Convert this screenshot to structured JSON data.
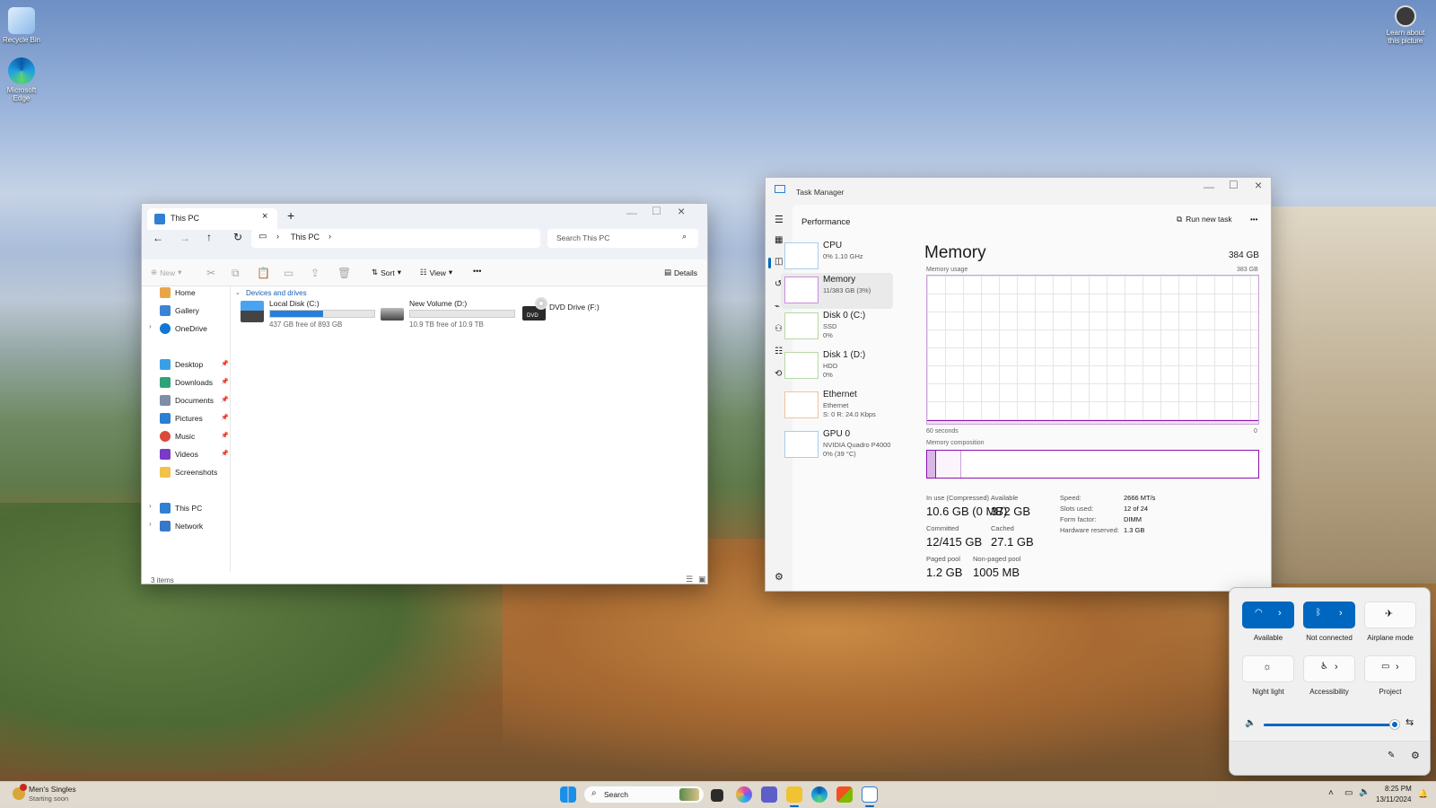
{
  "desktop": {
    "icons": [
      {
        "label": "Recycle Bin"
      },
      {
        "label": "Microsoft Edge"
      },
      {
        "label": "Learn about this picture"
      }
    ]
  },
  "explorer": {
    "tab_title": "This PC",
    "new_tab": "+",
    "breadcrumb": [
      "This PC"
    ],
    "search_placeholder": "Search This PC",
    "toolbar": {
      "new": "New",
      "sort": "Sort",
      "view": "View",
      "more": "•••",
      "details": "Details"
    },
    "nav": {
      "home": "Home",
      "gallery": "Gallery",
      "onedrive": "OneDrive",
      "desktop": "Desktop",
      "downloads": "Downloads",
      "documents": "Documents",
      "pictures": "Pictures",
      "music": "Music",
      "videos": "Videos",
      "screenshots": "Screenshots",
      "this_pc": "This PC",
      "network": "Network"
    },
    "section": "Devices and drives",
    "drives": [
      {
        "name": "Local Disk (C:)",
        "free": "437 GB free of 893 GB",
        "used_fraction": 0.51
      },
      {
        "name": "New Volume (D:)",
        "free": "10.9 TB free of 10.9 TB",
        "used_fraction": 0.0
      },
      {
        "name": "DVD Drive (F:)",
        "badge": "DVD"
      }
    ],
    "status": "3 items"
  },
  "taskmanager": {
    "title": "Task Manager",
    "page": "Performance",
    "run_task": "Run new task",
    "more": "•••",
    "items": [
      {
        "name": "CPU",
        "sub": "0% 1.10 GHz"
      },
      {
        "name": "Memory",
        "sub": "11/383 GB (3%)"
      },
      {
        "name": "Disk 0 (C:)",
        "sub": "SSD",
        "sub2": "0%"
      },
      {
        "name": "Disk 1 (D:)",
        "sub": "HDD",
        "sub2": "0%"
      },
      {
        "name": "Ethernet",
        "sub": "Ethernet",
        "sub2": "S: 0 R: 24.0 Kbps"
      },
      {
        "name": "GPU 0",
        "sub": "NVIDIA Quadro P4000",
        "sub2": "0% (39 °C)"
      }
    ],
    "memory": {
      "heading": "Memory",
      "total": "384 GB",
      "usage_label": "Memory usage",
      "usage_max": "383 GB",
      "time_left": "60 seconds",
      "time_right": "0",
      "composition_label": "Memory composition",
      "stats": {
        "in_use_l": "In use (Compressed)",
        "in_use_v": "10.6 GB (0 MB)",
        "available_l": "Available",
        "available_v": "372 GB",
        "committed_l": "Committed",
        "committed_v": "12/415 GB",
        "cached_l": "Cached",
        "cached_v": "27.1 GB",
        "paged_l": "Paged pool",
        "paged_v": "1.2 GB",
        "nonpaged_l": "Non-paged pool",
        "nonpaged_v": "1005 MB"
      },
      "specs": [
        {
          "l": "Speed:",
          "v": "2666 MT/s"
        },
        {
          "l": "Slots used:",
          "v": "12 of 24"
        },
        {
          "l": "Form factor:",
          "v": "DIMM"
        },
        {
          "l": "Hardware reserved:",
          "v": "1.3 GB"
        }
      ]
    }
  },
  "quick_settings": {
    "wifi": "Available",
    "bluetooth": "Not connected",
    "airplane": "Airplane mode",
    "night": "Night light",
    "accessibility": "Accessibility",
    "project": "Project",
    "volume_fraction": 0.97
  },
  "taskbar": {
    "widget_title": "Men's Singles",
    "widget_sub": "Starting soon",
    "search": "Search",
    "time": "8:25 PM",
    "date": "13/11/2024"
  },
  "colors": {
    "accent": "#0067c0",
    "memory": "#8b12ae"
  }
}
